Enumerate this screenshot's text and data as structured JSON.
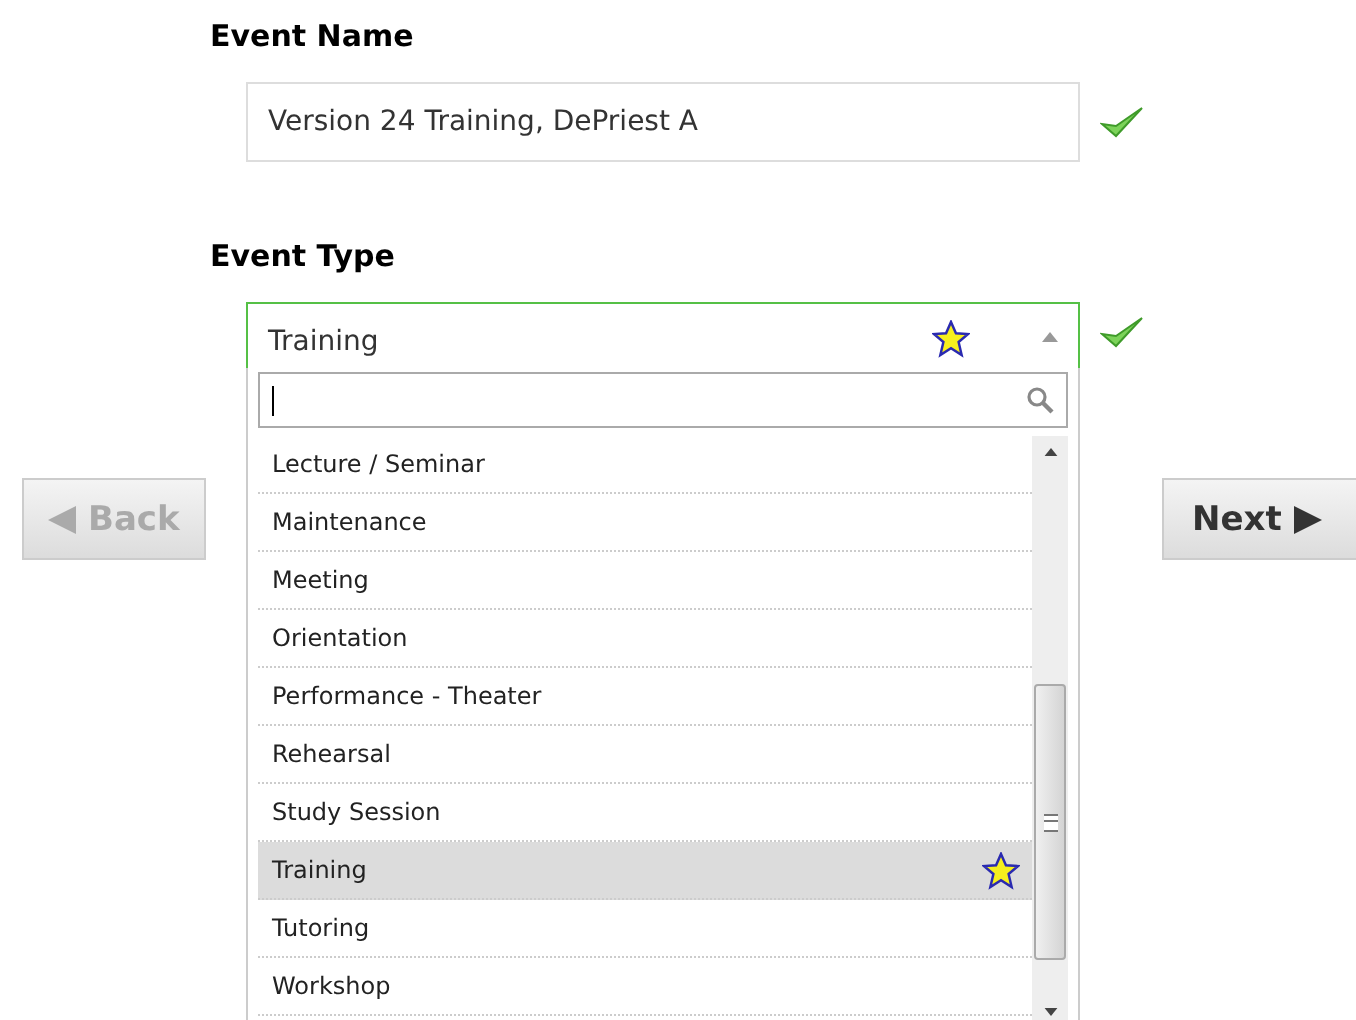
{
  "event_name": {
    "label": "Event Name",
    "value": "Version 24 Training, DePriest A",
    "valid": true
  },
  "event_type": {
    "label": "Event Type",
    "value": "Training",
    "starred": true,
    "valid": true,
    "expanded": true,
    "search": {
      "focused": true
    },
    "options": [
      {
        "label": "Lecture / Seminar",
        "selected": false,
        "starred": false
      },
      {
        "label": "Maintenance",
        "selected": false,
        "starred": false
      },
      {
        "label": "Meeting",
        "selected": false,
        "starred": false
      },
      {
        "label": "Orientation",
        "selected": false,
        "starred": false
      },
      {
        "label": "Performance - Theater",
        "selected": false,
        "starred": false
      },
      {
        "label": "Rehearsal",
        "selected": false,
        "starred": false
      },
      {
        "label": "Study Session",
        "selected": false,
        "starred": false
      },
      {
        "label": "Training",
        "selected": true,
        "starred": true
      },
      {
        "label": "Tutoring",
        "selected": false,
        "starred": false
      },
      {
        "label": "Workshop",
        "selected": false,
        "starred": false
      }
    ]
  },
  "buttons": [
    {
      "kind": "back",
      "label": "Back",
      "disabled": true
    },
    {
      "kind": "next",
      "label": "Next",
      "disabled": false
    }
  ]
}
